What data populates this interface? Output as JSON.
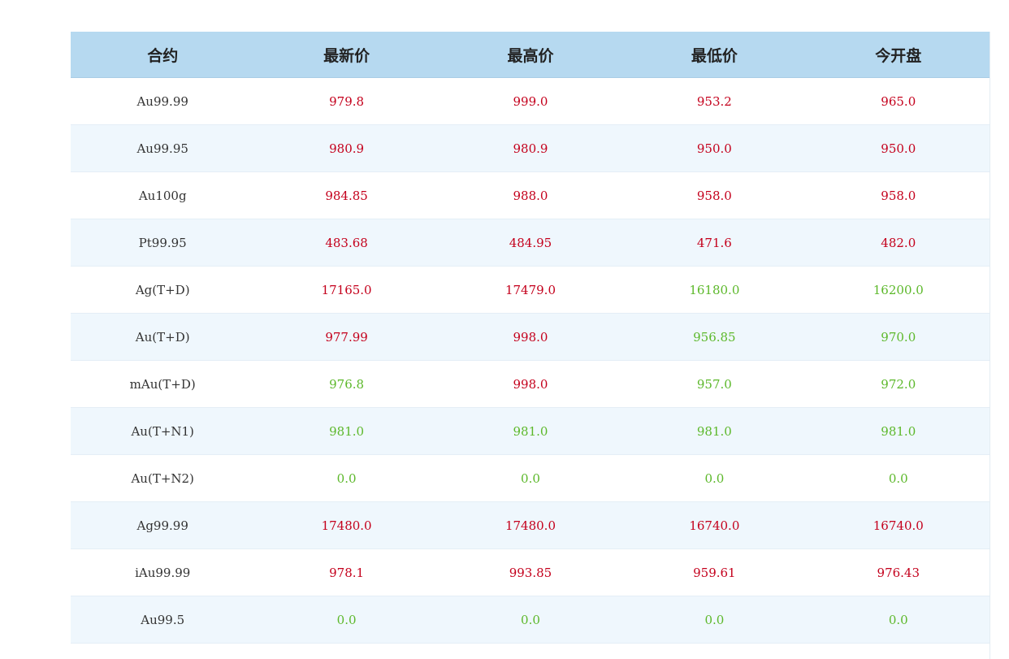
{
  "colors": {
    "header_bg": "#b6d9f0",
    "row_alt_bg": "#eff7fd",
    "up": "#c4001c",
    "down": "#5cb82a"
  },
  "table": {
    "headers": [
      "合约",
      "最新价",
      "最高价",
      "最低价",
      "今开盘"
    ],
    "rows": [
      {
        "name": "Au99.99",
        "cells": [
          {
            "value": "979.8",
            "trend": "up"
          },
          {
            "value": "999.0",
            "trend": "up"
          },
          {
            "value": "953.2",
            "trend": "up"
          },
          {
            "value": "965.0",
            "trend": "up"
          }
        ]
      },
      {
        "name": "Au99.95",
        "cells": [
          {
            "value": "980.9",
            "trend": "up"
          },
          {
            "value": "980.9",
            "trend": "up"
          },
          {
            "value": "950.0",
            "trend": "up"
          },
          {
            "value": "950.0",
            "trend": "up"
          }
        ]
      },
      {
        "name": "Au100g",
        "cells": [
          {
            "value": "984.85",
            "trend": "up"
          },
          {
            "value": "988.0",
            "trend": "up"
          },
          {
            "value": "958.0",
            "trend": "up"
          },
          {
            "value": "958.0",
            "trend": "up"
          }
        ]
      },
      {
        "name": "Pt99.95",
        "cells": [
          {
            "value": "483.68",
            "trend": "up"
          },
          {
            "value": "484.95",
            "trend": "up"
          },
          {
            "value": "471.6",
            "trend": "up"
          },
          {
            "value": "482.0",
            "trend": "up"
          }
        ]
      },
      {
        "name": "Ag(T+D)",
        "cells": [
          {
            "value": "17165.0",
            "trend": "up"
          },
          {
            "value": "17479.0",
            "trend": "up"
          },
          {
            "value": "16180.0",
            "trend": "down"
          },
          {
            "value": "16200.0",
            "trend": "down"
          }
        ]
      },
      {
        "name": "Au(T+D)",
        "cells": [
          {
            "value": "977.99",
            "trend": "up"
          },
          {
            "value": "998.0",
            "trend": "up"
          },
          {
            "value": "956.85",
            "trend": "down"
          },
          {
            "value": "970.0",
            "trend": "down"
          }
        ]
      },
      {
        "name": "mAu(T+D)",
        "cells": [
          {
            "value": "976.8",
            "trend": "down"
          },
          {
            "value": "998.0",
            "trend": "up"
          },
          {
            "value": "957.0",
            "trend": "down"
          },
          {
            "value": "972.0",
            "trend": "down"
          }
        ]
      },
      {
        "name": "Au(T+N1)",
        "cells": [
          {
            "value": "981.0",
            "trend": "down"
          },
          {
            "value": "981.0",
            "trend": "down"
          },
          {
            "value": "981.0",
            "trend": "down"
          },
          {
            "value": "981.0",
            "trend": "down"
          }
        ]
      },
      {
        "name": "Au(T+N2)",
        "cells": [
          {
            "value": "0.0",
            "trend": "down"
          },
          {
            "value": "0.0",
            "trend": "down"
          },
          {
            "value": "0.0",
            "trend": "down"
          },
          {
            "value": "0.0",
            "trend": "down"
          }
        ]
      },
      {
        "name": "Ag99.99",
        "cells": [
          {
            "value": "17480.0",
            "trend": "up"
          },
          {
            "value": "17480.0",
            "trend": "up"
          },
          {
            "value": "16740.0",
            "trend": "up"
          },
          {
            "value": "16740.0",
            "trend": "up"
          }
        ]
      },
      {
        "name": "iAu99.99",
        "cells": [
          {
            "value": "978.1",
            "trend": "up"
          },
          {
            "value": "993.85",
            "trend": "up"
          },
          {
            "value": "959.61",
            "trend": "up"
          },
          {
            "value": "976.43",
            "trend": "up"
          }
        ]
      },
      {
        "name": "Au99.5",
        "cells": [
          {
            "value": "0.0",
            "trend": "down"
          },
          {
            "value": "0.0",
            "trend": "down"
          },
          {
            "value": "0.0",
            "trend": "down"
          },
          {
            "value": "0.0",
            "trend": "down"
          }
        ]
      }
    ]
  }
}
